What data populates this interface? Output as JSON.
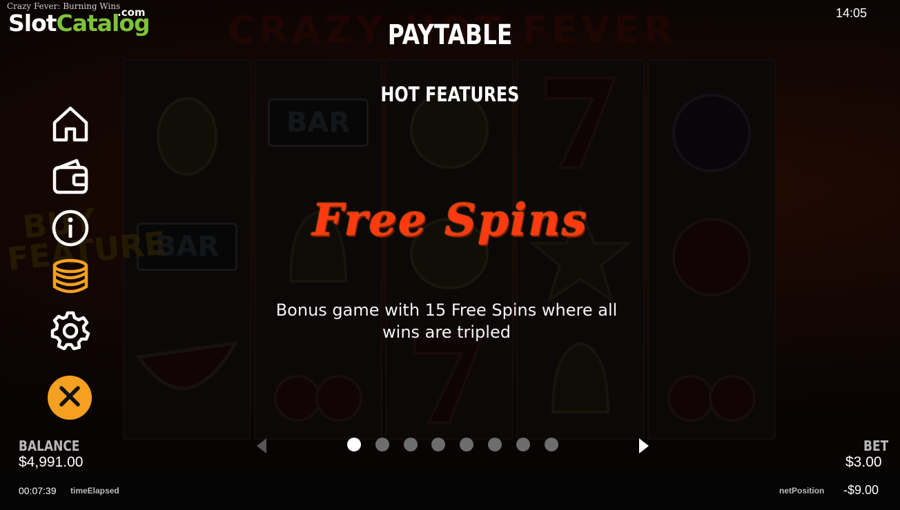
{
  "watermark": {
    "game_name": "Crazy Fever: Burning Wins",
    "logo_part1": "Slot",
    "logo_part2": "Catalog",
    "logo_suffix": ".com"
  },
  "background": {
    "game_logo": "CRAZY HOT FEVER",
    "bar_label": "BAR",
    "buy_feature": "BUY FEATURE"
  },
  "clock": "14:05",
  "paytable": {
    "title": "PAYTABLE",
    "section": "HOT FEATURES",
    "feature_title": "Free Spins",
    "feature_description": "Bonus game with 15 Free Spins where all wins are tripled"
  },
  "menu": {
    "items": [
      {
        "name": "home-icon"
      },
      {
        "name": "wallet-icon"
      },
      {
        "name": "info-icon"
      },
      {
        "name": "coins-icon",
        "active": true
      },
      {
        "name": "settings-icon"
      }
    ],
    "close_icon": "close-icon",
    "close_color": "#f5a021",
    "active_color": "#f5a021"
  },
  "pager": {
    "total_pages": 8,
    "current_page": 1
  },
  "balance": {
    "label": "BALANCE",
    "value": "$4,991.00"
  },
  "bet": {
    "label": "BET",
    "value": "$3.00"
  },
  "footer": {
    "time_elapsed_value": "00:07:39",
    "time_elapsed_label": "timeElapsed",
    "net_position_label": "netPosition",
    "net_position_value": "-$9.00"
  }
}
